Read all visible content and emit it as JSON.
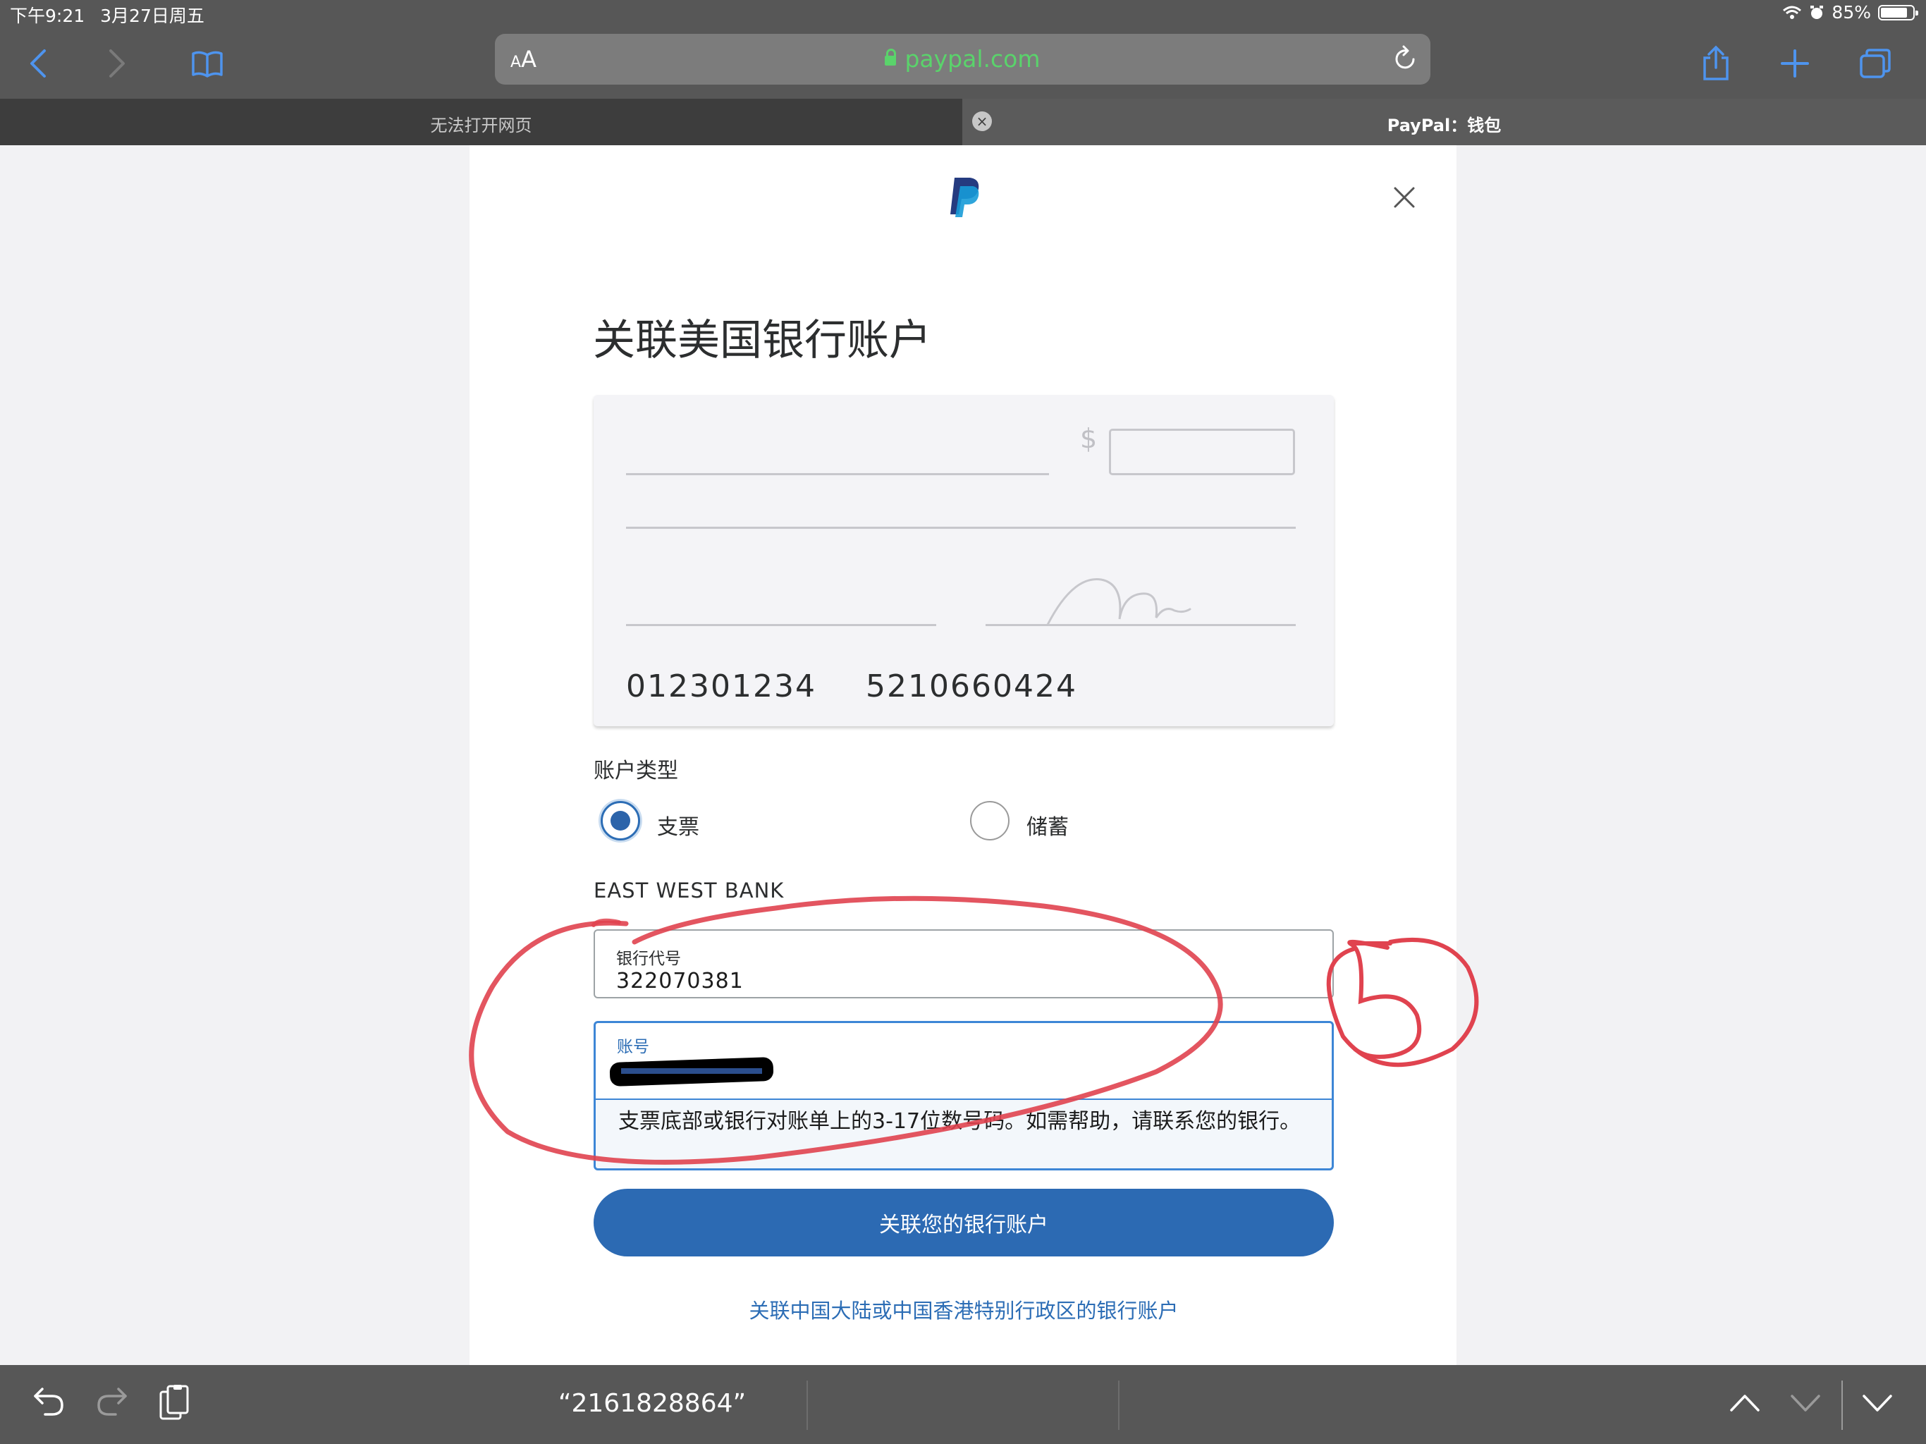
{
  "status": {
    "time": "下午9:21",
    "date": "3月27日周五",
    "battery": "85%",
    "battery_level": 0.85
  },
  "browser": {
    "aa_small": "A",
    "aa_large": "A",
    "url": "paypal.com",
    "tabs": [
      {
        "title": "无法打开网页",
        "active": false
      },
      {
        "title": "PayPal：钱包",
        "active": true
      }
    ]
  },
  "page": {
    "title": "关联美国银行账户",
    "check": {
      "dollar_sign": "$",
      "routing_number": "012301234",
      "account_number": "5210660424"
    },
    "account_type_label": "账户类型",
    "account_types": [
      {
        "label": "支票",
        "selected": true
      },
      {
        "label": "储蓄",
        "selected": false
      }
    ],
    "bank_name": "EAST WEST BANK",
    "routing_field": {
      "label": "银行代号",
      "value": "322070381"
    },
    "account_field": {
      "label": "账号"
    },
    "help_text": "支票底部或银行对账单上的3-17位数号码。如需帮助，请联系您的银行。",
    "submit_label": "关联您的银行账户",
    "alt_link": "关联中国大陆或中国香港特别行政区的银行账户"
  },
  "keyboard_bar": {
    "suggestion": "“2161828864”"
  },
  "colors": {
    "accent": "#2c6ab3",
    "url_green": "#5ad36b",
    "annotation_red": "#e0434f"
  }
}
